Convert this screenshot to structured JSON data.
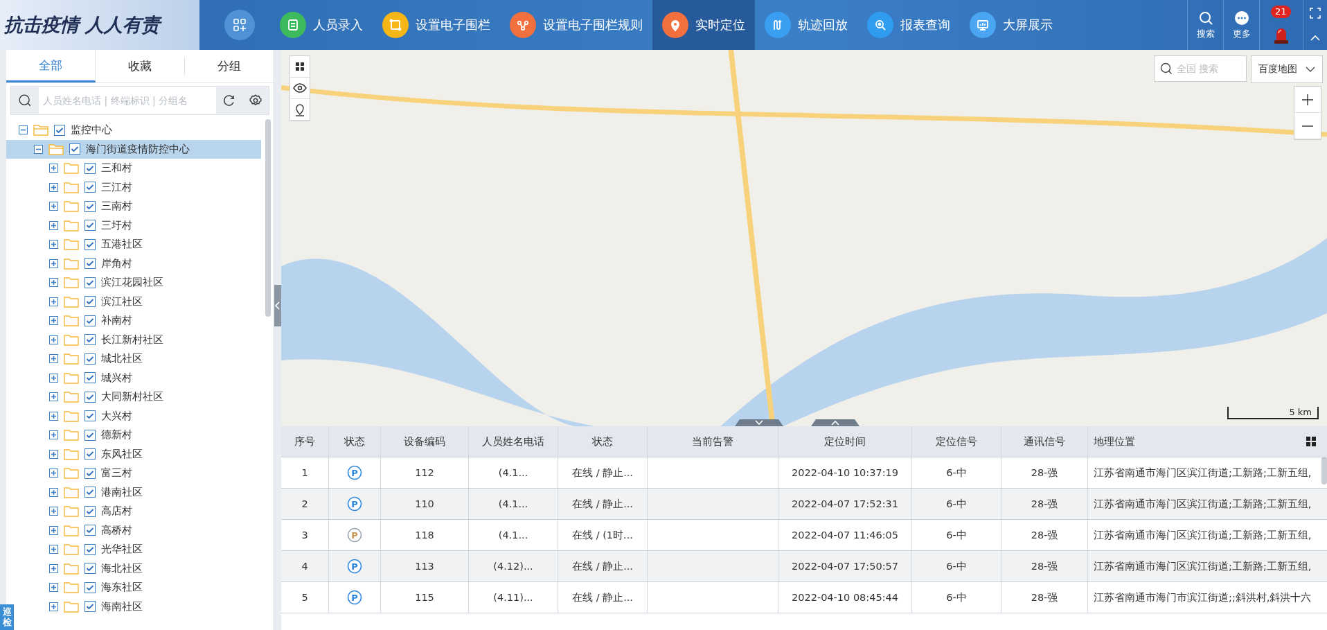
{
  "header": {
    "logo": "抗击疫情 人人有责",
    "nav": [
      {
        "label": "人员录入",
        "color": "#3dba5e",
        "selected": false
      },
      {
        "label": "设置电子围栏",
        "color": "#f5b616",
        "selected": false
      },
      {
        "label": "设置电子围栏规则",
        "color": "#f2703e",
        "selected": false
      },
      {
        "label": "实时定位",
        "color": "#f2703e",
        "selected": true
      },
      {
        "label": "轨迹回放",
        "color": "#3a9ff0",
        "selected": false
      },
      {
        "label": "报表查询",
        "color": "#2f9cf0",
        "selected": false
      },
      {
        "label": "大屏展示",
        "color": "#4aa6f2",
        "selected": false
      }
    ],
    "search_label": "搜索",
    "more_label": "更多",
    "alarm_count": "21"
  },
  "sidebar": {
    "tabs": [
      {
        "label": "全部",
        "selected": true
      },
      {
        "label": "收藏",
        "selected": false
      },
      {
        "label": "分组",
        "selected": false
      }
    ],
    "search": {
      "placeholder": "人员姓名电话 | 终端标识 | 分组名"
    },
    "tree": [
      {
        "label": "监控中心",
        "checked": true,
        "expanded": true,
        "selected": false,
        "children": [
          {
            "label": "海门街道疫情防控中心",
            "checked": true,
            "expanded": true,
            "selected": true,
            "children": [
              {
                "label": "三和村",
                "checked": true,
                "expanded": false,
                "selected": false
              },
              {
                "label": "三江村",
                "checked": true,
                "expanded": false,
                "selected": false
              },
              {
                "label": "三南村",
                "checked": true,
                "expanded": false,
                "selected": false
              },
              {
                "label": "三圩村",
                "checked": true,
                "expanded": false,
                "selected": false
              },
              {
                "label": "五港社区",
                "checked": true,
                "expanded": false,
                "selected": false
              },
              {
                "label": "岸角村",
                "checked": true,
                "expanded": false,
                "selected": false
              },
              {
                "label": "滨江花园社区",
                "checked": true,
                "expanded": false,
                "selected": false
              },
              {
                "label": "滨江社区",
                "checked": true,
                "expanded": false,
                "selected": false
              },
              {
                "label": "补南村",
                "checked": true,
                "expanded": false,
                "selected": false
              },
              {
                "label": "长江新村社区",
                "checked": true,
                "expanded": false,
                "selected": false
              },
              {
                "label": "城北社区",
                "checked": true,
                "expanded": false,
                "selected": false
              },
              {
                "label": "城兴村",
                "checked": true,
                "expanded": false,
                "selected": false
              },
              {
                "label": "大同新村社区",
                "checked": true,
                "expanded": false,
                "selected": false
              },
              {
                "label": "大兴村",
                "checked": true,
                "expanded": false,
                "selected": false
              },
              {
                "label": "德新村",
                "checked": true,
                "expanded": false,
                "selected": false
              },
              {
                "label": "东风社区",
                "checked": true,
                "expanded": false,
                "selected": false
              },
              {
                "label": "富三村",
                "checked": true,
                "expanded": false,
                "selected": false
              },
              {
                "label": "港南社区",
                "checked": true,
                "expanded": false,
                "selected": false
              },
              {
                "label": "高店村",
                "checked": true,
                "expanded": false,
                "selected": false
              },
              {
                "label": "高桥村",
                "checked": true,
                "expanded": false,
                "selected": false
              },
              {
                "label": "光华社区",
                "checked": true,
                "expanded": false,
                "selected": false
              },
              {
                "label": "海北社区",
                "checked": true,
                "expanded": false,
                "selected": false
              },
              {
                "label": "海东社区",
                "checked": true,
                "expanded": false,
                "selected": false
              },
              {
                "label": "海南社区",
                "checked": true,
                "expanded": false,
                "selected": false
              }
            ]
          }
        ]
      }
    ],
    "side_tab": "巡检"
  },
  "map": {
    "search": {
      "placeholder": "全国 搜索"
    },
    "map_type": "百度地图",
    "scale": "5 km"
  },
  "table": {
    "columns": [
      "序号",
      "状态",
      "设备编码",
      "人员姓名电话",
      "状态",
      "当前告警",
      "定位时间",
      "定位信号",
      "通讯信号",
      "地理位置"
    ],
    "rows": [
      {
        "no": "1",
        "icon": "P",
        "active": true,
        "code": "112",
        "person": "(4.1...",
        "state": "在线 / 静止...",
        "time": "2022-04-10 10:37:19",
        "gps": "6-中",
        "comm": "28-强",
        "location": "江苏省南通市海门区滨江街道;工新路;工新五组,"
      },
      {
        "no": "2",
        "icon": "P",
        "active": true,
        "code": "110",
        "person": "(4.1...",
        "state": "在线 / 静止...",
        "time": "2022-04-07 17:52:31",
        "gps": "6-中",
        "comm": "28-强",
        "location": "江苏省南通市海门区滨江街道;工新路;工新五组,"
      },
      {
        "no": "3",
        "icon": "P",
        "active": false,
        "code": "118",
        "person": "(4.1...",
        "state": "在线 / (1时...",
        "time": "2022-04-07 11:46:05",
        "gps": "6-中",
        "comm": "28-强",
        "location": "江苏省南通市海门区滨江街道;工新路;工新五组,"
      },
      {
        "no": "4",
        "icon": "P",
        "active": true,
        "code": "113",
        "person": "(4.12)...",
        "state": "在线 / 静止...",
        "time": "2022-04-07 17:50:57",
        "gps": "6-中",
        "comm": "28-强",
        "location": "江苏省南通市海门区滨江街道;工新路;工新五组,"
      },
      {
        "no": "5",
        "icon": "P",
        "active": true,
        "code": "115",
        "person": "(4.11)...",
        "state": "在线 / 静止...",
        "time": "2022-04-10 08:45:44",
        "gps": "6-中",
        "comm": "28-强",
        "location": "江苏省南通市海门市滨江街道;;斜洪村,斜洪十六"
      }
    ]
  }
}
